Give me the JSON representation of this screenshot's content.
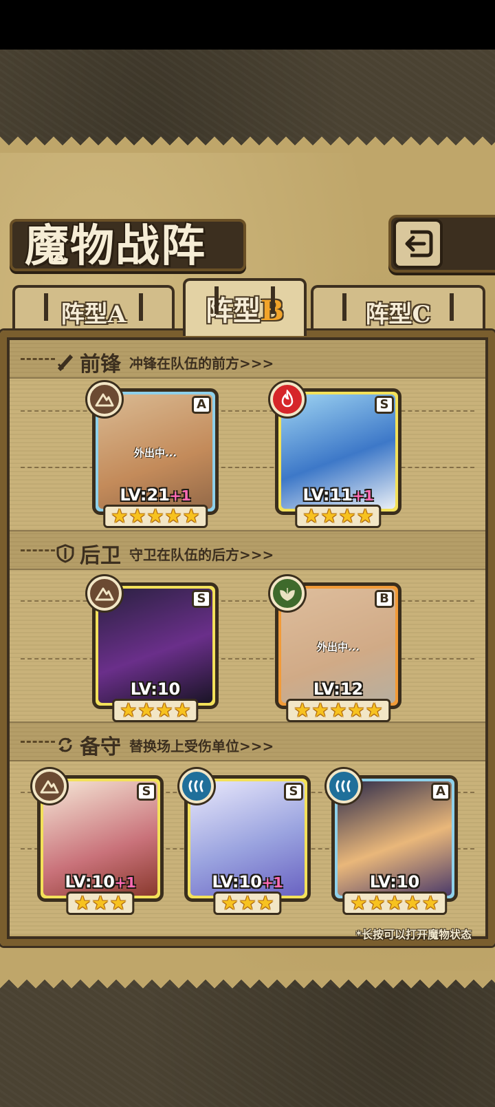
{
  "header": {
    "title": "魔物战阵"
  },
  "tabs": [
    {
      "label": "阵型",
      "letter": "A"
    },
    {
      "label": "阵型",
      "letter": "B"
    },
    {
      "label": "阵型",
      "letter": "C"
    }
  ],
  "sections": {
    "front": {
      "title": "前锋",
      "desc": "冲锋在队伍的前方>>>"
    },
    "rear": {
      "title": "后卫",
      "desc": "守卫在队伍的后方>>>"
    },
    "reserve": {
      "title": "备守",
      "desc": "替换场上受伤单位>>>"
    }
  },
  "monsters": [
    {
      "rank": "A",
      "level": "LV:21",
      "bonus": "+1",
      "stars": 5,
      "status": "外出中...",
      "element": "earth-icon",
      "frame": "#8ed0ea"
    },
    {
      "rank": "S",
      "level": "LV:11",
      "bonus": "+1",
      "stars": 4,
      "status": "",
      "element": "fire-icon",
      "frame": "#f3e15a"
    },
    {
      "rank": "S",
      "level": "LV:10",
      "bonus": "",
      "stars": 4,
      "status": "",
      "element": "earth-icon",
      "frame": "#f3e15a"
    },
    {
      "rank": "B",
      "level": "LV:12",
      "bonus": "",
      "stars": 5,
      "status": "外出中...",
      "element": "leaf-icon",
      "frame": "#f29b38"
    },
    {
      "rank": "S",
      "level": "LV:10",
      "bonus": "+1",
      "stars": 3,
      "status": "",
      "element": "earth-icon",
      "frame": "#f3e15a"
    },
    {
      "rank": "S",
      "level": "LV:10",
      "bonus": "+1",
      "stars": 3,
      "status": "",
      "element": "water-icon",
      "frame": "#f3e15a"
    },
    {
      "rank": "A",
      "level": "LV:10",
      "bonus": "",
      "stars": 5,
      "status": "",
      "element": "water-icon",
      "frame": "#8ed0ea"
    }
  ],
  "hint": "*长按可以打开魔物状态",
  "colors": {
    "parchment": "#bfa66a",
    "frame": "#7a5e2e",
    "earth": "#6b4a32",
    "fire": "#d6262a",
    "leaf": "#3e6a2c",
    "water": "#1f6f9a",
    "pink_bonus": "#ff6bb5"
  }
}
